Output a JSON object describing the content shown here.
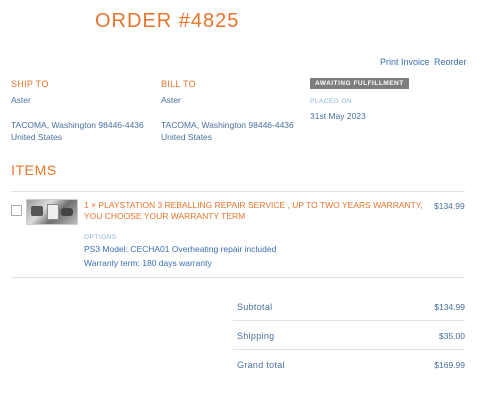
{
  "order": {
    "title": "ORDER #4825"
  },
  "actions": {
    "print_invoice": "Print Invoice",
    "reorder": "Reorder"
  },
  "ship_to": {
    "label": "SHIP TO",
    "name": "Aster",
    "address_line": "TACOMA, Washington 98446-4436",
    "country": "United States"
  },
  "bill_to": {
    "label": "BILL TO",
    "name": "Aster",
    "address_line": "TACOMA, Washington 98446-4436",
    "country": "United States"
  },
  "status": {
    "badge": "AWAITING FULFILLMENT",
    "placed_label": "PLACED ON",
    "placed_date": "31st May 2023"
  },
  "items": {
    "heading": "ITEMS",
    "list": [
      {
        "title": "1 × PLAYSTATION 3 REBALLING REPAIR SERVICE , UP TO TWO YEARS WARRANTY, YOU CHOOSE YOUR WARRANTY TERM",
        "price": "$134.99",
        "options_label": "OPTIONS",
        "options": [
          "PS3 Model: CECHA01 Overheating repair included",
          "Warranty term: 180 days warranty"
        ]
      }
    ]
  },
  "totals": {
    "subtotal_label": "Subtotal",
    "subtotal": "$134.99",
    "shipping_label": "Shipping",
    "shipping": "$35.00",
    "grand_label": "Grand total",
    "grand": "$169.99"
  }
}
